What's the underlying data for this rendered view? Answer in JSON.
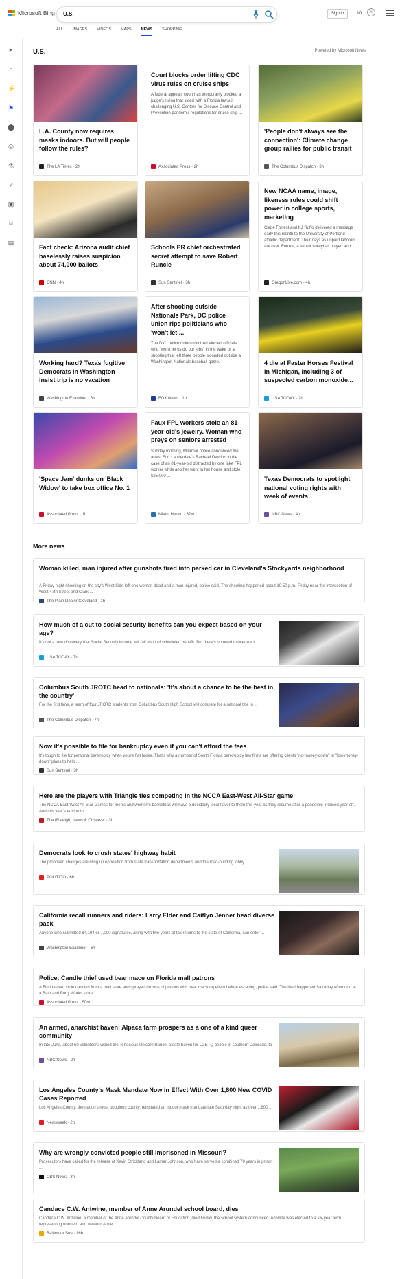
{
  "header": {
    "logo_text": "Microsoft Bing",
    "query": "U.S.",
    "signin": "Sign in",
    "points": "10"
  },
  "nav": [
    "ALL",
    "IMAGES",
    "VIDEOS",
    "MAPS",
    "NEWS",
    "SHOPPING"
  ],
  "nav_active": "NEWS",
  "section": {
    "title": "U.S.",
    "powered": "Powered by Microsoft News"
  },
  "cards": [
    {
      "title": "L.A. County now requires masks indoors. But will people follow the rules?",
      "excerpt": "",
      "source": "The LA Times",
      "time": "2h",
      "src_color": "#222"
    },
    {
      "title": "Court blocks order lifting CDC virus rules on cruise ships",
      "excerpt": "A federal appeals court has temporarily blocked a judge's ruling that sided with a Florida lawsuit challenging U.S. Centers for Disease Control and Prevention pandemic regulations for cruise ship ...",
      "source": "Associated Press",
      "time": "2h",
      "src_color": "#c8102e"
    },
    {
      "title": "'People don't always see the connection': Climate change group rallies for public transit",
      "excerpt": "",
      "source": "The Columbus Dispatch",
      "time": "3h",
      "src_color": "#555"
    },
    {
      "title": "Fact check: Arizona audit chief baselessly raises suspicion about 74,000 ballots",
      "excerpt": "",
      "source": "CNN",
      "time": "4h",
      "src_color": "#cc0000"
    },
    {
      "title": "Schools PR chief orchestrated secret attempt to save Robert Runcie",
      "excerpt": "",
      "source": "Sun Sentinel",
      "time": "3h",
      "src_color": "#333"
    },
    {
      "title": "New NCAA name, image, likeness rules could shift power in college sports, marketing",
      "excerpt": "Claire Forrest and KJ Ruffo delivered a message early this month to the University of Portland athletic department: Their days as unpaid laborers are over. Forrest, a senior volleyball player, and ...",
      "source": "OregonLive.com",
      "time": "4h",
      "src_color": "#222"
    },
    {
      "title": "Working hard? Texas fugitive Democrats in Washington insist trip is no vacation",
      "excerpt": "",
      "source": "Washington Examiner",
      "time": "6h",
      "src_color": "#444"
    },
    {
      "title": "After shooting outside Nationals Park, DC police union rips politicians who 'won't let ...",
      "excerpt": "The D.C. police union criticized elected officials who \"won't let us do our jobs\" in the wake of a shooting that left three people wounded outside a Washington Nationals baseball game.",
      "source": "FOX News",
      "time": "1h",
      "src_color": "#1b3e8a"
    },
    {
      "title": "4 die at Faster Horses Festival in Michigan, including 3 of suspected carbon monoxide...",
      "excerpt": "",
      "source": "USA TODAY",
      "time": "2h",
      "src_color": "#1a9bdc"
    },
    {
      "title": "'Space Jam' dunks on 'Black Widow' to take box office No. 1",
      "excerpt": "",
      "source": "Associated Press",
      "time": "1h",
      "src_color": "#c8102e"
    },
    {
      "title": "Faux FPL workers stole an 81-year-old's jewelry. Woman who preys on seniors arrested",
      "excerpt": "Sunday morning, Miramar police announced the arrest Fort Lauderdale's Rachael Demitro in the case of an 81-year-old distracted by one fake FPL worker while another went in her house and stole $25,000 ...",
      "source": "Miami Herald",
      "time": "32m",
      "src_color": "#2a6fb0"
    },
    {
      "title": "Texas Democrats to spotlight national voting rights with week of events",
      "excerpt": "",
      "source": "NBC News",
      "time": "4h",
      "src_color": "#6b4fa0"
    }
  ],
  "more_news_title": "More news",
  "more_news": [
    {
      "title": "Woman killed, man injured after gunshots fired into parked car in Cleveland's Stockyards neighborhood",
      "excerpt": "A Friday night shooting on the city's West Side left one woman dead and a man injured, police said. The shooting happened about 10:50 p.m. Friday near the intersection of West 47th Street and Clark ...",
      "source": "The Plain Dealer Cleveland",
      "time": "1h",
      "src_color": "#2b4a7a"
    },
    {
      "title": "How much of a cut to social security benefits can you expect based on your age?",
      "excerpt": "It's not a new discovery that Social Security income will fall short of scheduled benefit. But there's no need to overreact.",
      "source": "USA TODAY",
      "time": "7h",
      "src_color": "#1a9bdc"
    },
    {
      "title": "Columbus South JROTC head to nationals: 'It's about a chance to be the best in the country'",
      "excerpt": "For the first time, a team of four JROTC students from Columbus South High School will compete for a national title in ...",
      "source": "The Columbus Dispatch",
      "time": "7h",
      "src_color": "#555"
    },
    {
      "title": "Now it's possible to file for bankruptcy even if you can't afford the fees",
      "excerpt": "It's tough to file for personal bankruptcy when you're flat broke. That's why a number of South Florida bankruptcy law firms are offering clients \"no-money-down\" or \"low-money-down\" plans to help ...",
      "source": "Sun Sentinel",
      "time": "3h",
      "src_color": "#333"
    },
    {
      "title": "Here are the players with Triangle ties competing in the NCCA East-West All-Star game",
      "excerpt": "The NCCA East-West All-Star Games for men's and women's basketball will have a decidedly local flavor to them this year as they resume after a pandemic-induced year off. And this year's edition in ...",
      "source": "The (Raleigh) News & Observer",
      "time": "3h",
      "src_color": "#b22222"
    },
    {
      "title": "Democrats look to crush states' highway habit",
      "excerpt": "The proposed changes are riling up opposition from state transportation departments and the road-building lobby.",
      "source": "POLITICO",
      "time": "6h",
      "src_color": "#d22"
    },
    {
      "title": "California recall runners and riders: Larry Elder and Caitlyn Jenner head diverse pack",
      "excerpt": "Anyone who submitted $4,194 or 7,000 signatures, along with five years of tax returns to the state of California, can enter ...",
      "source": "Washington Examiner",
      "time": "6h",
      "src_color": "#444"
    },
    {
      "title": "Police: Candle thief used bear mace on Florida mall patrons",
      "excerpt": "A Florida man stole candles from a mall store and sprayed dozens of patrons with bear mace repellent before escaping, police said. The theft happened Saturday afternoon at a Bath and Body Works store ...",
      "source": "Associated Press",
      "time": "50m",
      "src_color": "#c8102e"
    },
    {
      "title": "An armed, anarchist haven: Alpaca farm prospers as a one of a kind queer community",
      "excerpt": "In late June, about 50 volunteers visited the Tenacious Unicorn Ranch, a safe haven for LGBTQ people in southern Colorado, to ...",
      "source": "NBC News",
      "time": "2h",
      "src_color": "#6b4fa0"
    },
    {
      "title": "Los Angeles County's Mask Mandate Now in Effect With Over 1,800 New COVID Cases Reported",
      "excerpt": "Los Angeles County, the nation's most populous county, reinstated an indoor mask mandate late Saturday night as over 1,800 ...",
      "source": "Newsweek",
      "time": "2h",
      "src_color": "#e01b24"
    },
    {
      "title": "Why are wrongly-convicted people still imprisoned in Missouri?",
      "excerpt": "Prosecutors have called for the release of Kevin Strickland and Lamar Johnson, who have served a combined 70 years in prison ...",
      "source": "CBS News",
      "time": "3h",
      "src_color": "#111"
    },
    {
      "title": "Candace C.W. Antwine, member of Anne Arundel school board, dies",
      "excerpt": "Candace C.W. Antwine, a member of the Anne Arundel County Board of Education, died Friday, the school system announced. Antwine was elected to a six-year term representing northern and western Anne ...",
      "source": "Baltimore Sun",
      "time": "16h",
      "src_color": "#e8a800"
    }
  ],
  "colors": {
    "accent": "#174ae4",
    "bing_blue": "#2a7ab8"
  }
}
